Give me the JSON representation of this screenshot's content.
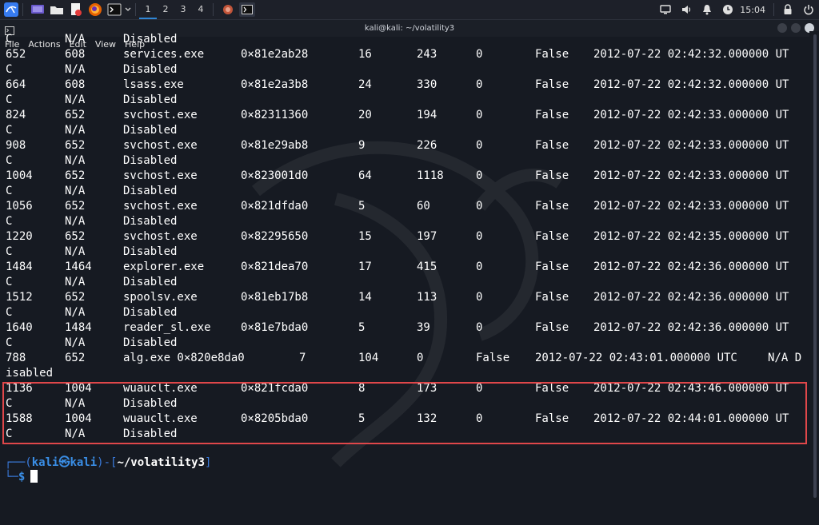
{
  "taskbar": {
    "workspaces": [
      "1",
      "2",
      "3",
      "4"
    ],
    "active_workspace": "1",
    "clock": "15:04",
    "colors": {
      "bg": "#1d2029",
      "accent": "#2f86d6"
    },
    "icons": [
      "kali-menu-icon",
      "desktop-icon",
      "file-manager-icon",
      "text-editor-icon",
      "firefox-icon",
      "terminal-icon",
      "chevron-down-icon",
      "app-icon",
      "terminal-icon",
      "monitor-icon",
      "volume-icon",
      "bell-icon",
      "clock-icon",
      "lock-icon",
      "power-icon"
    ]
  },
  "window": {
    "title": "kali@kali: ~/volatility3",
    "menu": [
      "File",
      "Actions",
      "Edit",
      "View",
      "Help"
    ]
  },
  "terminal": {
    "lines": [
      [
        "C",
        "N/A",
        "Disabled",
        "",
        "",
        "",
        "",
        "",
        ""
      ],
      [
        "652",
        "608",
        "services.exe",
        "0×81e2ab28",
        "16",
        "243",
        "0",
        "False",
        "2012-07-22 02:42:32.000000 UT"
      ],
      [
        "C",
        "N/A",
        "Disabled",
        "",
        "",
        "",
        "",
        "",
        ""
      ],
      [
        "664",
        "608",
        "lsass.exe",
        "0×81e2a3b8",
        "24",
        "330",
        "0",
        "False",
        "2012-07-22 02:42:32.000000 UT"
      ],
      [
        "C",
        "N/A",
        "Disabled",
        "",
        "",
        "",
        "",
        "",
        ""
      ],
      [
        "824",
        "652",
        "svchost.exe",
        "0×82311360",
        "20",
        "194",
        "0",
        "False",
        "2012-07-22 02:42:33.000000 UT"
      ],
      [
        "C",
        "N/A",
        "Disabled",
        "",
        "",
        "",
        "",
        "",
        ""
      ],
      [
        "908",
        "652",
        "svchost.exe",
        "0×81e29ab8",
        "9",
        "226",
        "0",
        "False",
        "2012-07-22 02:42:33.000000 UT"
      ],
      [
        "C",
        "N/A",
        "Disabled",
        "",
        "",
        "",
        "",
        "",
        ""
      ],
      [
        "1004",
        "652",
        "svchost.exe",
        "0×823001d0",
        "64",
        "1118",
        "0",
        "False",
        "2012-07-22 02:42:33.000000 UT"
      ],
      [
        "C",
        "N/A",
        "Disabled",
        "",
        "",
        "",
        "",
        "",
        ""
      ],
      [
        "1056",
        "652",
        "svchost.exe",
        "0×821dfda0",
        "5",
        "60",
        "0",
        "False",
        "2012-07-22 02:42:33.000000 UT"
      ],
      [
        "C",
        "N/A",
        "Disabled",
        "",
        "",
        "",
        "",
        "",
        ""
      ],
      [
        "1220",
        "652",
        "svchost.exe",
        "0×82295650",
        "15",
        "197",
        "0",
        "False",
        "2012-07-22 02:42:35.000000 UT"
      ],
      [
        "C",
        "N/A",
        "Disabled",
        "",
        "",
        "",
        "",
        "",
        ""
      ],
      [
        "1484",
        "1464",
        "explorer.exe",
        "0×821dea70",
        "17",
        "415",
        "0",
        "False",
        "2012-07-22 02:42:36.000000 UT"
      ],
      [
        "C",
        "N/A",
        "Disabled",
        "",
        "",
        "",
        "",
        "",
        ""
      ],
      [
        "1512",
        "652",
        "spoolsv.exe",
        "0×81eb17b8",
        "14",
        "113",
        "0",
        "False",
        "2012-07-22 02:42:36.000000 UT"
      ],
      [
        "C",
        "N/A",
        "Disabled",
        "",
        "",
        "",
        "",
        "",
        ""
      ],
      [
        "1640",
        "1484",
        "reader_sl.exe",
        "0×81e7bda0",
        "5",
        "39",
        "0",
        "False",
        "2012-07-22 02:42:36.000000 UT"
      ],
      [
        "C",
        "N/A",
        "Disabled",
        "",
        "",
        "",
        "",
        "",
        ""
      ],
      [
        "788",
        "652",
        "alg.exe 0×820e8da0",
        "7",
        "104",
        "0",
        "False",
        "2012-07-22 02:43:01.000000 UTC",
        "N/A D"
      ],
      [
        "isabled",
        "",
        "",
        "",
        "",
        "",
        "",
        "",
        ""
      ],
      [
        "1136",
        "1004",
        "wuauclt.exe",
        "0×821fcda0",
        "8",
        "173",
        "0",
        "False",
        "2012-07-22 02:43:46.000000 UT"
      ],
      [
        "C",
        "N/A",
        "Disabled",
        "",
        "",
        "",
        "",
        "",
        ""
      ],
      [
        "1588",
        "1004",
        "wuauclt.exe",
        "0×8205bda0",
        "5",
        "132",
        "0",
        "False",
        "2012-07-22 02:44:01.000000 UT"
      ],
      [
        "C",
        "N/A",
        "Disabled",
        "",
        "",
        "",
        "",
        "",
        ""
      ]
    ],
    "prompt": {
      "user": "kali",
      "host": "kali",
      "at_symbol": "㉿",
      "dir": "~/volatility3",
      "symbol": "$"
    },
    "highlight_color": "#e0474a"
  }
}
